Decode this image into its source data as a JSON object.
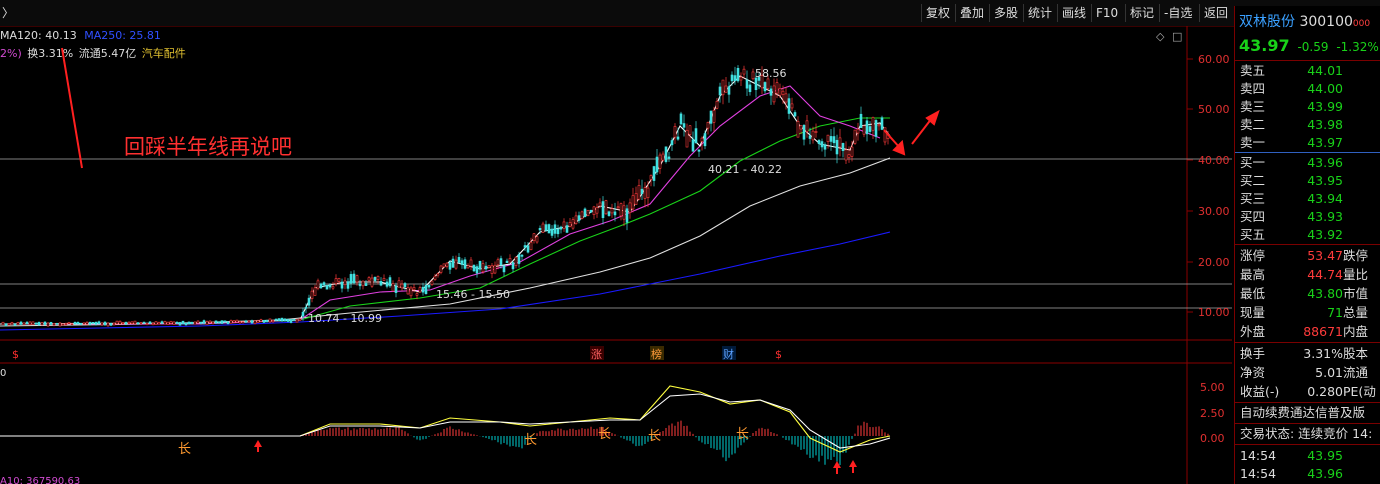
{
  "toolbar": {
    "back_glyph": "〉",
    "buttons": [
      "复权",
      "叠加",
      "多股",
      "统计",
      "画线",
      "F10",
      "标记",
      "-自选",
      "返回"
    ]
  },
  "indicators": {
    "ma120": "MA120: 40.13",
    "ma250": "MA250: 25.81",
    "pct_prefix": "2%)",
    "turnover": "换3.31%",
    "float_cap": "流通5.47亿",
    "sector": "汽车配件"
  },
  "annotation_text": "回踩半年线再说吧",
  "price_axis": [
    "60.00",
    "50.00",
    "40.00",
    "30.00",
    "20.00",
    "10.00"
  ],
  "price_labels": {
    "high": "58.56",
    "mid": "40.21 - 40.22",
    "low1": "15.46 - 15.50",
    "low2": "10.74 - 10.99"
  },
  "event_markers": {
    "zhang": "涨",
    "bang": "榜",
    "cai": "财",
    "s": "$"
  },
  "macd_axis": [
    "5.00",
    "2.50",
    "0.00"
  ],
  "sub_labels": {
    "top": "0",
    "bottom": "A10: 367590.63"
  },
  "stock": {
    "name": "双林股份",
    "code": "300100",
    "code_suffix": "000",
    "price": "43.97",
    "change": "-0.59",
    "pct": "-1.32%"
  },
  "sells": [
    {
      "label": "卖五",
      "price": "44.01"
    },
    {
      "label": "卖四",
      "price": "44.00"
    },
    {
      "label": "卖三",
      "price": "43.99"
    },
    {
      "label": "卖二",
      "price": "43.98"
    },
    {
      "label": "卖一",
      "price": "43.97"
    }
  ],
  "buys": [
    {
      "label": "买一",
      "price": "43.96"
    },
    {
      "label": "买二",
      "price": "43.95"
    },
    {
      "label": "买三",
      "price": "43.94"
    },
    {
      "label": "买四",
      "price": "43.93"
    },
    {
      "label": "买五",
      "price": "43.92"
    }
  ],
  "stats": [
    {
      "label": "涨停",
      "value": "53.47",
      "ext": "跌停"
    },
    {
      "label": "最高",
      "value": "44.74",
      "ext": "量比"
    },
    {
      "label": "最低",
      "value": "43.80",
      "ext": "市值"
    },
    {
      "label": "现量",
      "value": "71",
      "ext": "总量"
    },
    {
      "label": "外盘",
      "value": "88671",
      "ext": "内盘"
    }
  ],
  "stats2": [
    {
      "label": "换手",
      "value": "3.31%",
      "ext": "股本"
    },
    {
      "label": "净资",
      "value": "5.01",
      "ext": "流通"
    },
    {
      "label": "收益(-)",
      "value": "0.280",
      "ext": "PE(动"
    }
  ],
  "news": "自动续费通达信普及版",
  "trade_status": "交易状态: 连续竞价 14:",
  "ticks": [
    {
      "time": "14:54",
      "price": "43.95"
    },
    {
      "time": "14:54",
      "price": "43.96"
    }
  ],
  "colors": {
    "up": "#ff3b3b",
    "down": "#19d219",
    "ma120": "#e8e8e8",
    "ma250": "#1414ff",
    "macd_pos": "#ff3b3b",
    "macd_neg": "#00ced1"
  }
}
